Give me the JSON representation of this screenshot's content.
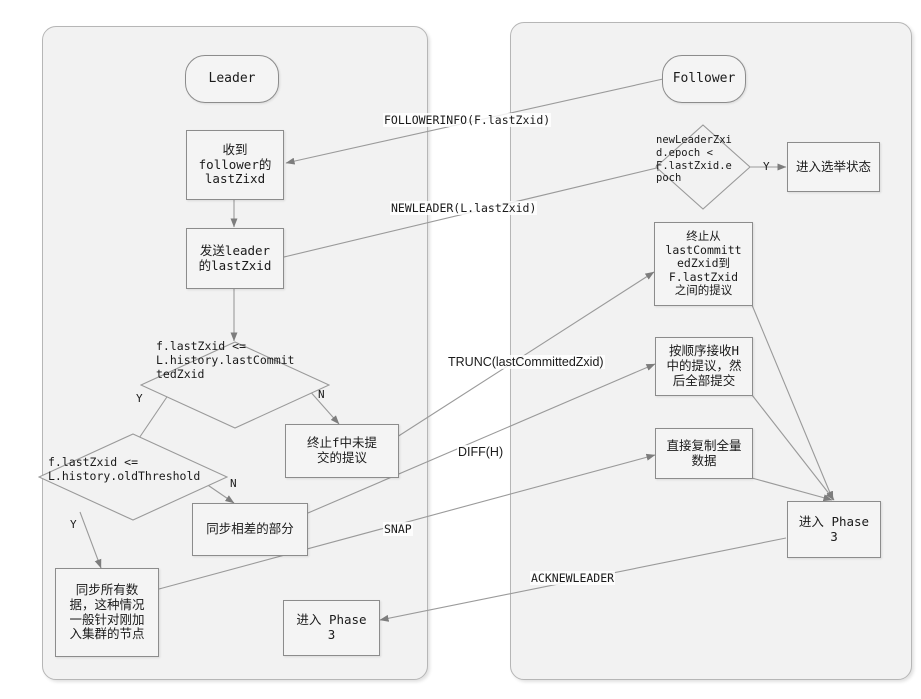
{
  "diagram": {
    "title": "ZAB Phase 2 Leader/Follower Synchronization Flowchart",
    "colors": {
      "panel_fill": "#f2f2f2",
      "panel_border": "#b6b6b6",
      "node_fill": "#f4f4f4",
      "node_border": "#8c8c8c",
      "edge": "#9a9a9a",
      "text": "#1a1a1a"
    }
  },
  "panels": [
    {
      "id": "leader-panel",
      "name": "Leader lane"
    },
    {
      "id": "follower-panel",
      "name": "Follower lane"
    }
  ],
  "leader": {
    "start": "Leader",
    "nodes": {
      "recv_follower_zxid": "收到\nfollower的\nlastZixd",
      "send_leader_zxid": "发送leader\n的lastZxid",
      "decision_lastcommitted": "f.lastZxid <=\nL.history.lastCommit\ntedZxid",
      "abort_uncommitted": "终止f中未提\n交的提议",
      "decision_oldthreshold": "f.lastZxid <=\nL.history.oldThreshold",
      "sync_diff_part": "同步相差的部分",
      "sync_all_data": "同步所有数\n据，这种情况\n一般针对刚加\n入集群的节点",
      "enter_phase3": "进入 Phase\n3"
    }
  },
  "follower": {
    "start": "Follower",
    "nodes": {
      "decision_epoch": "newLeaderZxi\nd.epoch <\nF.lastZxid.e\npoch",
      "enter_election": "进入选举状态",
      "abort_proposals": "终止从\nlastCommitt\nedZxid到\nF.lastZxid\n之间的提议",
      "recv_ordered_commit": "按顺序接收H\n中的提议，然\n后全部提交",
      "copy_full_data": "直接复制全量\n数据",
      "enter_phase3": "进入 Phase\n3"
    }
  },
  "branch_labels": {
    "decision_lastcommitted_yes": "Y",
    "decision_lastcommitted_no": "N",
    "decision_oldthreshold_yes": "Y",
    "decision_oldthreshold_no": "N",
    "decision_epoch_yes": "Y"
  },
  "messages": [
    {
      "id": "followerinfo",
      "label": "FOLLOWERINFO(F.lastZxid)",
      "font": "mono"
    },
    {
      "id": "newleader",
      "label": "NEWLEADER(L.lastZxid)",
      "font": "mono"
    },
    {
      "id": "trunc",
      "label": "TRUNC(lastCommittedZxid)",
      "font": "sans"
    },
    {
      "id": "diff",
      "label": "DIFF(H)",
      "font": "sans"
    },
    {
      "id": "snap",
      "label": "SNAP",
      "font": "mono"
    },
    {
      "id": "acknewleader",
      "label": "ACKNEWLEADER",
      "font": "mono"
    }
  ]
}
